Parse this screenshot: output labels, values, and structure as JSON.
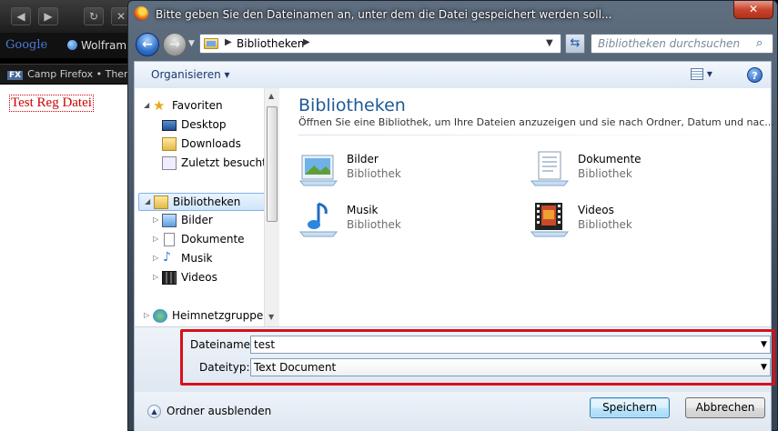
{
  "browser": {
    "search_logo": "Google",
    "bookmark": "Wolfram",
    "tab_title": "Camp Firefox • Them",
    "tab_icon_text": "FX",
    "page_link": "Test Reg Datei"
  },
  "dialog": {
    "title": "Bitte geben Sie den Dateinamen an, unter dem die Datei gespeichert werden soll...",
    "close_label": "✕",
    "breadcrumb": [
      "Bibliotheken"
    ],
    "search_placeholder": "Bibliotheken durchsuchen",
    "toolbar": {
      "organize_label": "Organisieren ▾"
    },
    "nav": {
      "favorites": "Favoriten",
      "desktop": "Desktop",
      "downloads": "Downloads",
      "recent": "Zuletzt besucht",
      "libraries": "Bibliotheken",
      "pictures": "Bilder",
      "documents": "Dokumente",
      "music": "Musik",
      "videos": "Videos",
      "homegroup": "Heimnetzgruppe"
    },
    "main": {
      "title": "Bibliotheken",
      "subtitle": "Öffnen Sie eine Bibliothek, um Ihre Dateien anzuzeigen und sie nach Ordner, Datum und nac...",
      "libraries": [
        {
          "name": "Bilder",
          "type": "Bibliothek",
          "icon": "pictures-library-icon"
        },
        {
          "name": "Dokumente",
          "type": "Bibliothek",
          "icon": "documents-library-icon"
        },
        {
          "name": "Musik",
          "type": "Bibliothek",
          "icon": "music-library-icon"
        },
        {
          "name": "Videos",
          "type": "Bibliothek",
          "icon": "videos-library-icon"
        }
      ]
    },
    "fields": {
      "filename_label": "Dateiname:",
      "filename_value": "test",
      "filetype_label": "Dateityp:",
      "filetype_value": "Text Document"
    },
    "footer": {
      "hide_folders": "Ordner ausblenden",
      "save": "Speichern",
      "cancel": "Abbrechen"
    }
  },
  "colors": {
    "highlight": "#d8101a",
    "title_blue": "#1e5a96",
    "link_red": "#cc0000"
  }
}
